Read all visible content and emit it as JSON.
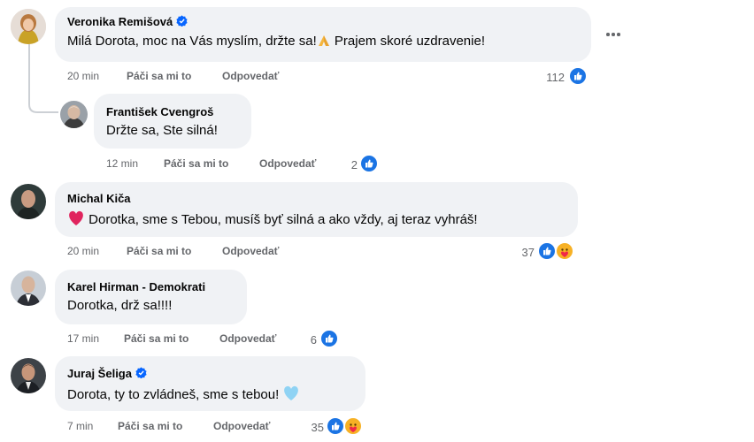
{
  "comments": [
    {
      "author": "Veronika Remišová",
      "verified": true,
      "text": "Milá Dorota, moc na Vás myslím, držte sa!",
      "text_after_emoji": " Prajem skoré uzdravenie!",
      "emoji": "folded-hands",
      "time": "20 min",
      "like_label": "Páči sa mi to",
      "reply_label": "Odpovedať",
      "reactions_count": "112",
      "reactions": [
        "like"
      ]
    },
    {
      "author": "František Cvengroš",
      "verified": false,
      "text": "Držte sa, Ste silná!",
      "time": "12 min",
      "like_label": "Páči sa mi to",
      "reply_label": "Odpovedať",
      "reactions_count": "2",
      "reactions": [
        "like"
      ],
      "is_reply": true
    },
    {
      "author": "Michal Kiča",
      "verified": false,
      "emoji": "red-heart",
      "text": " Dorotka, sme s Tebou, musíš byť silná a ako vždy, aj teraz vyhráš!",
      "time": "20 min",
      "like_label": "Páči sa mi to",
      "reply_label": "Odpovedať",
      "reactions_count": "37",
      "reactions": [
        "like",
        "care"
      ]
    },
    {
      "author": "Karel Hirman - Demokrati",
      "verified": false,
      "text": "Dorotka, drž sa!!!!",
      "time": "17 min",
      "like_label": "Páči sa mi to",
      "reply_label": "Odpovedať",
      "reactions_count": "6",
      "reactions": [
        "like"
      ]
    },
    {
      "author": "Juraj Šeliga",
      "verified": true,
      "text": "Dorota, ty to zvládneš, sme s tebou! ",
      "emoji": "light-blue-heart",
      "time": "7 min",
      "like_label": "Páči sa mi to",
      "reply_label": "Odpovedať",
      "reactions_count": "35",
      "reactions": [
        "like",
        "care"
      ]
    }
  ],
  "colors": {
    "bubble": "#f0f2f5",
    "secondary_text": "#65676b",
    "like_blue": "#1b74e4",
    "verified_blue": "#0866ff"
  }
}
